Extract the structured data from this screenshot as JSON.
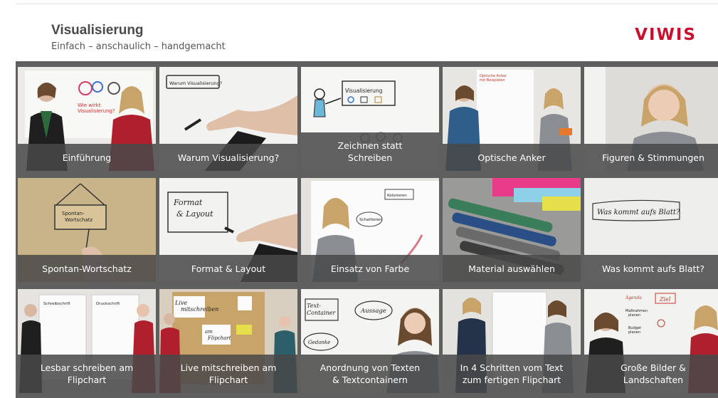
{
  "header": {
    "title": "Visualisierung",
    "subtitle": "Einfach – anschaulich – handgemacht",
    "logo": "VIWIS",
    "logo_color": "#c8102e"
  },
  "colors": {
    "gallery_background": "#5f5f5f",
    "caption_background": "#484848",
    "caption_text": "#ffffff",
    "title_text": "#4a4a4a"
  },
  "tiles": [
    {
      "label": "Einführung"
    },
    {
      "label": "Warum Visualisierung?"
    },
    {
      "label": "Zeichnen statt\nSchreiben"
    },
    {
      "label": "Optische Anker"
    },
    {
      "label": "Figuren & Stimmungen"
    },
    {
      "label": "Spontan-Wortschatz"
    },
    {
      "label": "Format & Layout"
    },
    {
      "label": "Einsatz von Farbe"
    },
    {
      "label": "Material auswählen"
    },
    {
      "label": "Was kommt aufs Blatt?"
    },
    {
      "label": "Lesbar schreiben am\nFlipchart"
    },
    {
      "label": "Live mitschreiben am\nFlipchart"
    },
    {
      "label": "Anordnung von Texten\n& Textcontainern"
    },
    {
      "label": "In 4 Schritten vom Text\nzum fertigen Flipchart"
    },
    {
      "label": "Große Bilder &\nLandschaften"
    }
  ],
  "board_text": {
    "tile0": "Wie wirkt\nVisualisierung?",
    "tile1": "Warum Visualisierung?",
    "tile2": "Visualisierung",
    "tile3": "Optische Anker\nmit Beispielen",
    "tile5": "Spontan-\nWortschatz",
    "tile6": "Format\n& Layout",
    "tile7a": "Kolorieren",
    "tile7b": "Schattieren",
    "tile9": "Was kommt aufs Blatt?",
    "tile10a": "Schreibschrift",
    "tile10b": "Druckschrift",
    "tile11a": "Live\nmitschreiben",
    "tile11b": "am\nFlipchart",
    "tile12a": "Text-\nContainer",
    "tile12b": "Aussage",
    "tile12c": "Gedanke",
    "tile14a": "Agenda",
    "tile14b": "Ziel",
    "tile14c": "Maßnahmen\nplanen",
    "tile14d": "Budget\nplanen"
  }
}
